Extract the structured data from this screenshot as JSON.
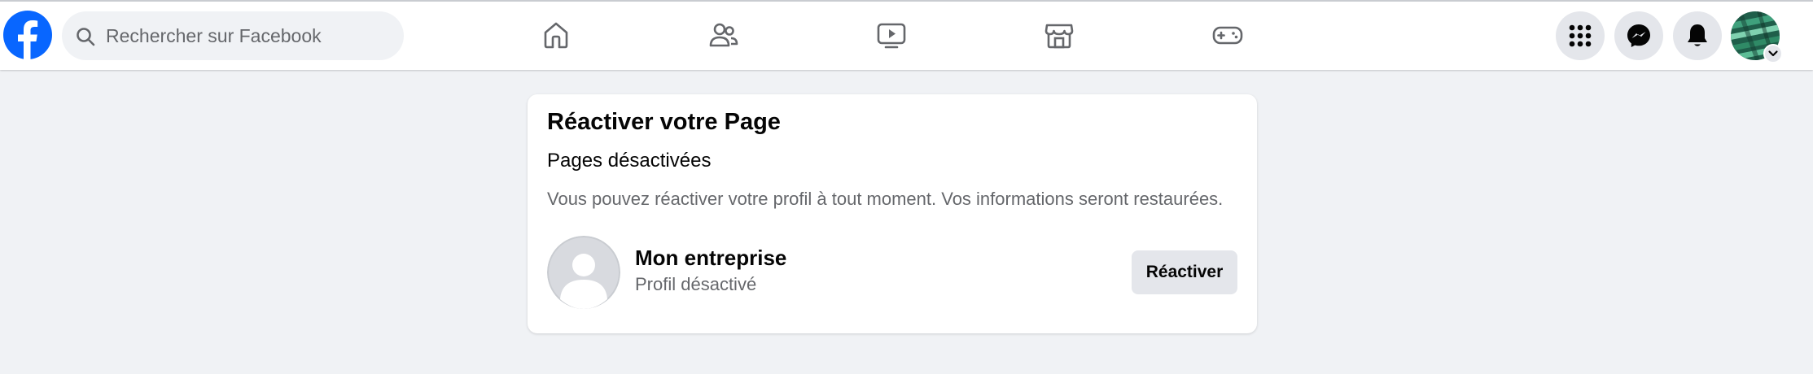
{
  "app": {
    "brand_color": "#0866ff"
  },
  "header": {
    "logo_icon": "facebook-logo-icon",
    "search": {
      "placeholder": "Rechercher sur Facebook",
      "icon": "search-icon"
    },
    "nav_tabs": [
      {
        "icon": "home-icon"
      },
      {
        "icon": "friends-icon"
      },
      {
        "icon": "video-icon"
      },
      {
        "icon": "marketplace-icon"
      },
      {
        "icon": "gaming-icon"
      }
    ],
    "actions": [
      {
        "icon": "menu-grid-icon"
      },
      {
        "icon": "messenger-icon"
      },
      {
        "icon": "notifications-bell-icon"
      }
    ],
    "account": {
      "icon": "avatar",
      "caret_icon": "chevron-down-icon"
    }
  },
  "card": {
    "title": "Réactiver votre Page",
    "subtitle": "Pages désactivées",
    "description": "Vous pouvez réactiver votre profil à tout moment. Vos informations seront restaurées.",
    "page": {
      "name": "Mon entreprise",
      "status": "Profil désactivé",
      "avatar_icon": "default-profile-icon"
    },
    "button_label": "Réactiver"
  }
}
